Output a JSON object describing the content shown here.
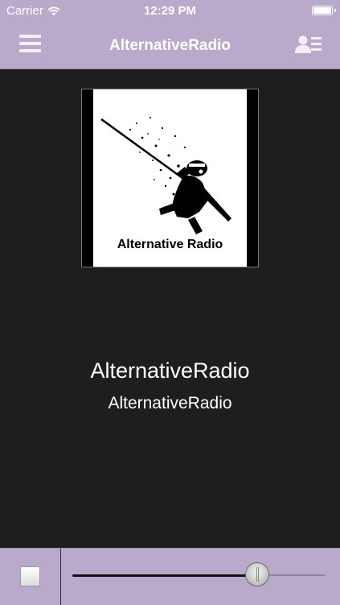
{
  "status_bar": {
    "carrier": "Carrier",
    "time": "12:29 PM",
    "battery_level": 1.0
  },
  "nav": {
    "title": "AlternativeRadio",
    "left_icon": "menu-icon",
    "right_icon": "profile-card-icon"
  },
  "artwork": {
    "caption": "Alternative Radio"
  },
  "now_playing": {
    "title": "AlternativeRadio",
    "subtitle": "AlternativeRadio"
  },
  "player": {
    "stop_icon": "stop-icon",
    "volume": 0.73
  },
  "colors": {
    "bar": "#b9aacb",
    "background": "#1e1e1e",
    "text": "#ffffff"
  }
}
